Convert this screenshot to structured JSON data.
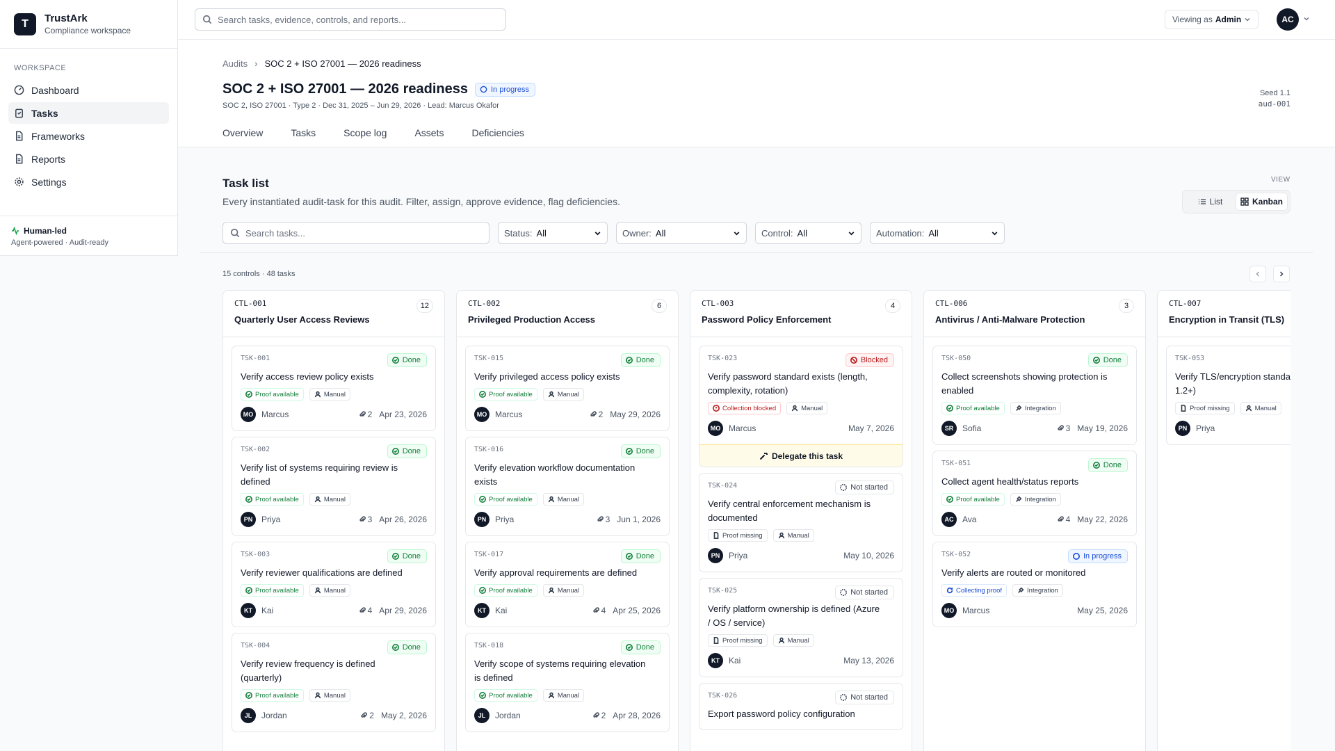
{
  "app": {
    "name": "TrustArk",
    "subtitle": "Compliance workspace",
    "logo_letter": "T"
  },
  "sidebar": {
    "section": "WORKSPACE",
    "items": [
      {
        "label": "Dashboard",
        "icon": "gauge-icon"
      },
      {
        "label": "Tasks",
        "icon": "clipboard-icon",
        "active": true
      },
      {
        "label": "Frameworks",
        "icon": "file-icon"
      },
      {
        "label": "Reports",
        "icon": "file-icon"
      },
      {
        "label": "Settings",
        "icon": "gear-icon"
      }
    ],
    "footer": {
      "title": "Human-led",
      "subtitle": "Agent-powered · Audit-ready"
    }
  },
  "topbar": {
    "search_placeholder": "Search tasks, evidence, controls, and reports...",
    "viewing_as_label": "Viewing as",
    "viewing_as_role": "Admin",
    "user_initials": "AC"
  },
  "page": {
    "breadcrumb": [
      "Audits",
      "SOC 2 + ISO 27001 — 2026 readiness"
    ],
    "title": "SOC 2 + ISO 27001 — 2026 readiness",
    "status": "In progress",
    "meta": "SOC 2, ISO 27001 · Type 2 · Dec 31, 2025 – Jun 29, 2026 · Lead: Marcus Okafor",
    "seed_label": "Seed 1.1",
    "audit_id": "aud-001",
    "tabs": [
      "Overview",
      "Tasks",
      "Scope log",
      "Assets",
      "Deficiencies"
    ]
  },
  "tasklist": {
    "title": "Task list",
    "description": "Every instantiated audit-task for this audit. Filter, assign, approve evidence, flag deficiencies.",
    "view_label": "VIEW",
    "view_options": [
      "List",
      "Kanban"
    ],
    "active_view": "Kanban",
    "search_placeholder": "Search tasks...",
    "filters": [
      {
        "key": "Status:",
        "value": "All"
      },
      {
        "key": "Owner:",
        "value": "All"
      },
      {
        "key": "Control:",
        "value": "All"
      },
      {
        "key": "Automation:",
        "value": "All"
      }
    ],
    "summary": "15 controls · 48 tasks"
  },
  "colors": {
    "accent": "#111827",
    "done": "#15803d",
    "blocked": "#b91c1c",
    "in_progress": "#1d4ed8",
    "delegate_bg": "#fefce8"
  },
  "columns": [
    {
      "id": "CTL-001",
      "name": "Quarterly User Access Reviews",
      "count": "12",
      "cards": [
        {
          "id": "TSK-001",
          "status": "Done",
          "title": [
            "Verify access review policy exists"
          ],
          "chips": [
            {
              "t": "Proof available",
              "k": "green"
            },
            {
              "t": "Manual",
              "k": "manual"
            }
          ],
          "initials": "MO",
          "owner": "Marcus",
          "attachments": "2",
          "date": "Apr 23, 2026"
        },
        {
          "id": "TSK-002",
          "status": "Done",
          "title": [
            "Verify list of systems requiring review is",
            "defined"
          ],
          "chips": [
            {
              "t": "Proof available",
              "k": "green"
            },
            {
              "t": "Manual",
              "k": "manual"
            }
          ],
          "initials": "PN",
          "owner": "Priya",
          "attachments": "3",
          "date": "Apr 26, 2026"
        },
        {
          "id": "TSK-003",
          "status": "Done",
          "title": [
            "Verify reviewer qualifications are defined"
          ],
          "chips": [
            {
              "t": "Proof available",
              "k": "green"
            },
            {
              "t": "Manual",
              "k": "manual"
            }
          ],
          "initials": "KT",
          "owner": "Kai",
          "attachments": "4",
          "date": "Apr 29, 2026"
        },
        {
          "id": "TSK-004",
          "status": "Done",
          "title": [
            "Verify review frequency is defined",
            "(quarterly)"
          ],
          "chips": [
            {
              "t": "Proof available",
              "k": "green"
            },
            {
              "t": "Manual",
              "k": "manual"
            }
          ],
          "initials": "JL",
          "owner": "Jordan",
          "attachments": "2",
          "date": "May 2, 2026"
        }
      ]
    },
    {
      "id": "CTL-002",
      "name": "Privileged Production Access",
      "count": "6",
      "cards": [
        {
          "id": "TSK-015",
          "status": "Done",
          "title": [
            "Verify privileged access policy exists"
          ],
          "chips": [
            {
              "t": "Proof available",
              "k": "green"
            },
            {
              "t": "Manual",
              "k": "manual"
            }
          ],
          "initials": "MO",
          "owner": "Marcus",
          "attachments": "2",
          "date": "May 29, 2026"
        },
        {
          "id": "TSK-016",
          "status": "Done",
          "title": [
            "Verify elevation workflow documentation",
            "exists"
          ],
          "chips": [
            {
              "t": "Proof available",
              "k": "green"
            },
            {
              "t": "Manual",
              "k": "manual"
            }
          ],
          "initials": "PN",
          "owner": "Priya",
          "attachments": "3",
          "date": "Jun 1, 2026"
        },
        {
          "id": "TSK-017",
          "status": "Done",
          "title": [
            "Verify approval requirements are defined"
          ],
          "chips": [
            {
              "t": "Proof available",
              "k": "green"
            },
            {
              "t": "Manual",
              "k": "manual"
            }
          ],
          "initials": "KT",
          "owner": "Kai",
          "attachments": "4",
          "date": "Apr 25, 2026"
        },
        {
          "id": "TSK-018",
          "status": "Done",
          "title": [
            "Verify scope of systems requiring elevation",
            "is defined"
          ],
          "chips": [
            {
              "t": "Proof available",
              "k": "green"
            },
            {
              "t": "Manual",
              "k": "manual"
            }
          ],
          "initials": "JL",
          "owner": "Jordan",
          "attachments": "2",
          "date": "Apr 28, 2026"
        }
      ]
    },
    {
      "id": "CTL-003",
      "name": "Password Policy Enforcement",
      "count": "4",
      "cards": [
        {
          "id": "TSK-023",
          "status": "Blocked",
          "title": [
            "Verify password standard exists (length,",
            "complexity, rotation)"
          ],
          "chips": [
            {
              "t": "Collection blocked",
              "k": "red"
            },
            {
              "t": "Manual",
              "k": "manual"
            }
          ],
          "initials": "MO",
          "owner": "Marcus",
          "attachments": "",
          "date": "May 7, 2026",
          "delegate": "Delegate this task"
        },
        {
          "id": "TSK-024",
          "status": "Not started",
          "title": [
            "Verify central enforcement mechanism is",
            "documented"
          ],
          "chips": [
            {
              "t": "Proof missing",
              "k": "missing"
            },
            {
              "t": "Manual",
              "k": "manual"
            }
          ],
          "initials": "PN",
          "owner": "Priya",
          "attachments": "",
          "date": "May 10, 2026"
        },
        {
          "id": "TSK-025",
          "status": "Not started",
          "title": [
            "Verify platform ownership is defined (Azure",
            "/ OS / service)"
          ],
          "chips": [
            {
              "t": "Proof missing",
              "k": "missing"
            },
            {
              "t": "Manual",
              "k": "manual"
            }
          ],
          "initials": "KT",
          "owner": "Kai",
          "attachments": "",
          "date": "May 13, 2026"
        },
        {
          "id": "TSK-026",
          "status": "Not started",
          "title": [
            "Export password policy configuration"
          ],
          "chips": [],
          "initials": "",
          "owner": "",
          "attachments": "",
          "date": ""
        }
      ]
    },
    {
      "id": "CTL-006",
      "name": "Antivirus / Anti-Malware Protection",
      "count": "3",
      "cards": [
        {
          "id": "TSK-050",
          "status": "Done",
          "title": [
            "Collect screenshots showing protection is",
            "enabled"
          ],
          "chips": [
            {
              "t": "Proof available",
              "k": "green"
            },
            {
              "t": "Integration",
              "k": "integration"
            }
          ],
          "initials": "SR",
          "owner": "Sofia",
          "attachments": "3",
          "date": "May 19, 2026"
        },
        {
          "id": "TSK-051",
          "status": "Done",
          "title": [
            "Collect agent health/status reports"
          ],
          "chips": [
            {
              "t": "Proof available",
              "k": "green"
            },
            {
              "t": "Integration",
              "k": "integration"
            }
          ],
          "initials": "AC",
          "owner": "Ava",
          "attachments": "4",
          "date": "May 22, 2026"
        },
        {
          "id": "TSK-052",
          "status": "In progress",
          "title": [
            "Verify alerts are routed or monitored"
          ],
          "chips": [
            {
              "t": "Collecting proof",
              "k": "blue"
            },
            {
              "t": "Integration",
              "k": "integration"
            }
          ],
          "initials": "MO",
          "owner": "Marcus",
          "attachments": "",
          "date": "May 25, 2026"
        }
      ]
    },
    {
      "id": "CTL-007",
      "name": "Encryption in Transit (TLS)",
      "count": "",
      "cards": [
        {
          "id": "TSK-053",
          "status": "",
          "title": [
            "Verify TLS/encryption standard",
            "1.2+)"
          ],
          "chips": [
            {
              "t": "Proof missing",
              "k": "missing"
            },
            {
              "t": "Manual",
              "k": "manual"
            }
          ],
          "initials": "PN",
          "owner": "Priya",
          "attachments": "",
          "date": ""
        }
      ]
    }
  ]
}
